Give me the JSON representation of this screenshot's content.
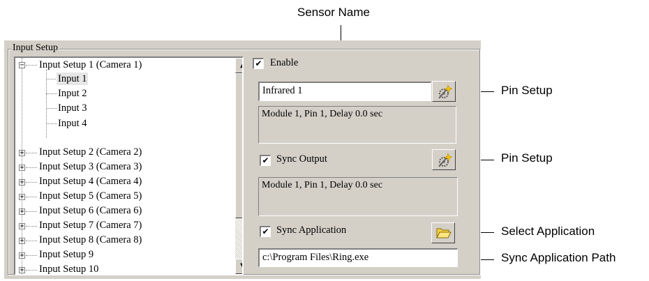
{
  "callouts": {
    "sensor_name": "Sensor Name",
    "pin_setup_1": "Pin Setup",
    "pin_setup_2": "Pin Setup",
    "select_application": "Select Application",
    "sync_application_path": "Sync Application Path"
  },
  "group": {
    "title": "Input Setup"
  },
  "tree": {
    "items": [
      {
        "label": "Input Setup 1 (Camera 1)",
        "expanded": true
      },
      {
        "label": "Input 1",
        "selected": true
      },
      {
        "label": "Input 2"
      },
      {
        "label": "Input 3"
      },
      {
        "label": "Input 4"
      },
      {
        "label": "Input Setup 2 (Camera 2)"
      },
      {
        "label": "Input Setup 3 (Camera 3)"
      },
      {
        "label": "Input Setup 4 (Camera 4)"
      },
      {
        "label": "Input Setup 5 (Camera 5)"
      },
      {
        "label": "Input Setup 6 (Camera 6)"
      },
      {
        "label": "Input Setup 7 (Camera 7)"
      },
      {
        "label": "Input Setup 8 (Camera 8)"
      },
      {
        "label": "Input Setup 9"
      },
      {
        "label": "Input Setup 10"
      }
    ],
    "expand_symbol": "+",
    "collapse_symbol": "−"
  },
  "scrollbar": {
    "up": "▲",
    "down": "▼"
  },
  "enable": {
    "label": "Enable",
    "checked": true,
    "mark": "✔"
  },
  "sensor_name": {
    "value": "Infrared 1"
  },
  "input_info": "Module 1, Pin 1, Delay 0.0 sec",
  "sync_output": {
    "label": "Sync Output",
    "checked": true,
    "mark": "✔"
  },
  "output_info": "Module 1, Pin 1, Delay 0.0 sec",
  "sync_application": {
    "label": "Sync Application",
    "checked": true,
    "mark": "✔"
  },
  "app_path": {
    "value": "c:\\Program Files\\Ring.exe"
  },
  "icons": {
    "pin_setup": "pin-setup-icon",
    "folder": "folder-open-icon"
  }
}
